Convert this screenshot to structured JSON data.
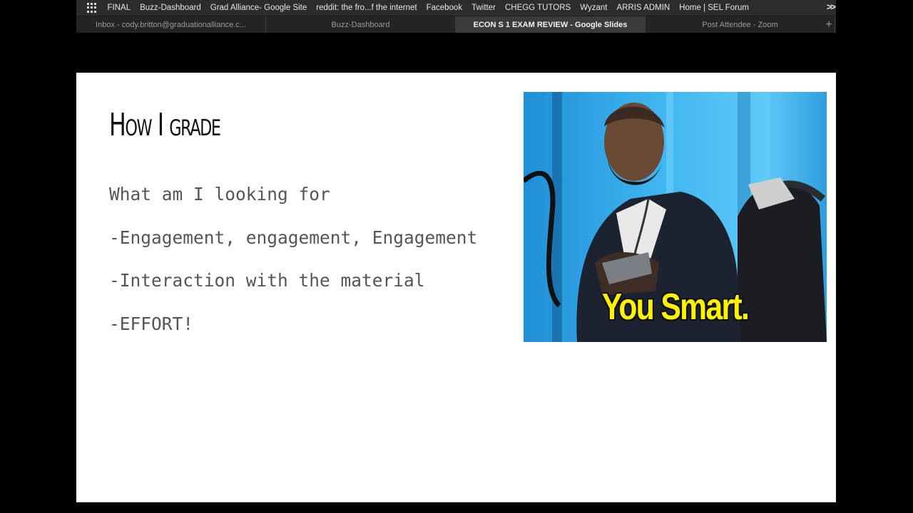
{
  "bookmarks": [
    "FINAL",
    "Buzz-Dashboard",
    "Grad Alliance- Google Site",
    "reddit: the fro...f the internet",
    "Facebook",
    "Twitter",
    "CHEGG TUTORS",
    "Wyzant",
    "ARRIS ADMIN",
    "Home | SEL Forum"
  ],
  "bookmarks_more": ">>",
  "tabs": [
    {
      "label": "Inbox - cody.britton@graduationalliance.c...",
      "active": false
    },
    {
      "label": "Buzz-Dashboard",
      "active": false
    },
    {
      "label": "ECON S 1 EXAM REVIEW - Google Slides",
      "active": true
    },
    {
      "label": "Post Attendee - Zoom",
      "active": false
    }
  ],
  "new_tab": "+",
  "slide": {
    "title": "How I grade",
    "bullets": [
      "What am I looking for",
      "-Engagement, engagement, Engagement",
      "-Interaction with the material",
      "-EFFORT!"
    ],
    "image_caption": "You Smart."
  },
  "icons": {
    "apps": "apps-grid-icon"
  },
  "colors": {
    "caption": "#fff200",
    "image_background": "#2aa6e8"
  }
}
